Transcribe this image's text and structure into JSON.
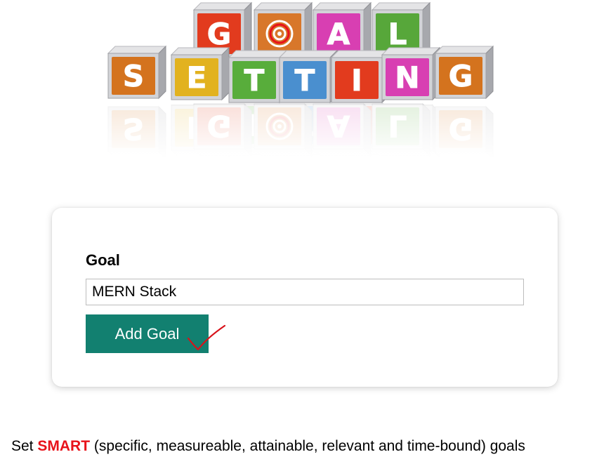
{
  "logo": {
    "top_letters": [
      "G",
      "O",
      "A",
      "L"
    ],
    "bottom_letters": [
      "S",
      "E",
      "T",
      "T",
      "I",
      "N",
      "G"
    ],
    "top_colors": [
      "#e23b1e",
      "#d8772a",
      "#d83fb2",
      "#57a73a"
    ],
    "bottom_colors": [
      "#d4731e",
      "#e2b21f",
      "#58ad3b",
      "#4a8fcf",
      "#e23b1e",
      "#d83fb2",
      "#d4731e"
    ]
  },
  "form": {
    "label": "Goal",
    "input_value": "MERN Stack",
    "button_label": "Add Goal",
    "button_color": "#128070"
  },
  "hint": {
    "prefix": "Set",
    "highlight": "SMART",
    "suffix": "(specific, measureable, attainable, relevant and time-bound) goals",
    "highlight_color": "#e8121a"
  },
  "annotation": {
    "icon": "checkmark-icon",
    "color": "#d8121a"
  }
}
